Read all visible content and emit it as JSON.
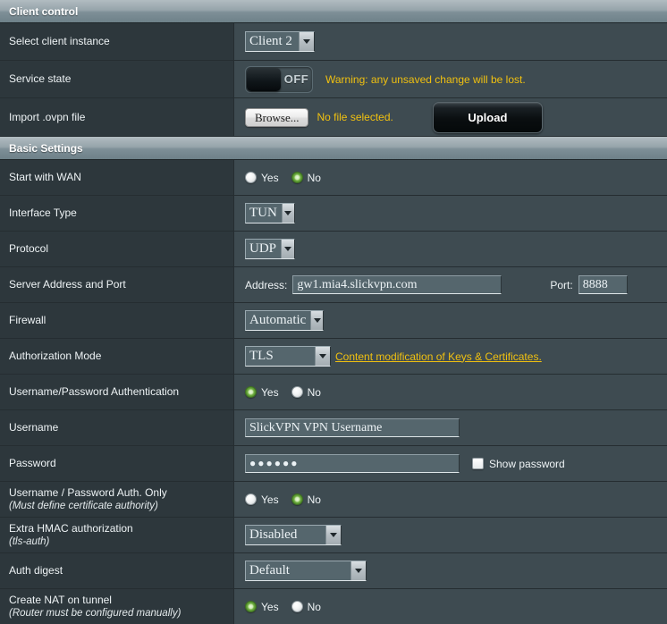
{
  "sections": [
    {
      "title": "Client control"
    },
    {
      "title": "Basic Settings"
    }
  ],
  "client_control": {
    "select_client_instance": {
      "label": "Select client instance",
      "value": "Client 2"
    },
    "service_state": {
      "label": "Service state",
      "toggle_state": "OFF",
      "warning": "Warning: any unsaved change will be lost."
    },
    "import_ovpn": {
      "label": "Import .ovpn file",
      "browse_label": "Browse...",
      "file_status": "No file selected.",
      "upload_label": "Upload"
    }
  },
  "basic_settings": {
    "start_with_wan": {
      "label": "Start with WAN",
      "yes_label": "Yes",
      "no_label": "No",
      "selected": "No"
    },
    "interface_type": {
      "label": "Interface Type",
      "value": "TUN"
    },
    "protocol": {
      "label": "Protocol",
      "value": "UDP"
    },
    "server_address_port": {
      "label": "Server Address and Port",
      "address_label": "Address:",
      "address_value": "gw1.mia4.slickvpn.com",
      "port_label": "Port:",
      "port_value": "8888"
    },
    "firewall": {
      "label": "Firewall",
      "value": "Automatic"
    },
    "authorization_mode": {
      "label": "Authorization Mode",
      "value": "TLS",
      "link_text": "Content modification of Keys & Certificates."
    },
    "username_password_auth": {
      "label": "Username/Password Authentication",
      "yes_label": "Yes",
      "no_label": "No",
      "selected": "Yes"
    },
    "username": {
      "label": "Username",
      "value": "SlickVPN VPN Username"
    },
    "password": {
      "label": "Password",
      "value": "●●●●●●",
      "show_password_label": "Show password",
      "show_password_checked": false
    },
    "username_password_only": {
      "label": "Username / Password Auth. Only",
      "sublabel": "(Must define certificate authority)",
      "yes_label": "Yes",
      "no_label": "No",
      "selected": "No"
    },
    "extra_hmac": {
      "label": "Extra HMAC authorization",
      "sublabel": "(tls-auth)",
      "value": "Disabled"
    },
    "auth_digest": {
      "label": "Auth digest",
      "value": "Default"
    },
    "create_nat": {
      "label": "Create NAT on tunnel",
      "sublabel": "(Router must be configured manually)",
      "yes_label": "Yes",
      "no_label": "No",
      "selected": "Yes"
    }
  },
  "colors": {
    "warning_text": "#f0c010",
    "link": "#f0c010",
    "radio_selected": "#72b043",
    "row_label_bg": "#2d373c",
    "row_value_bg": "#3e4b51"
  }
}
